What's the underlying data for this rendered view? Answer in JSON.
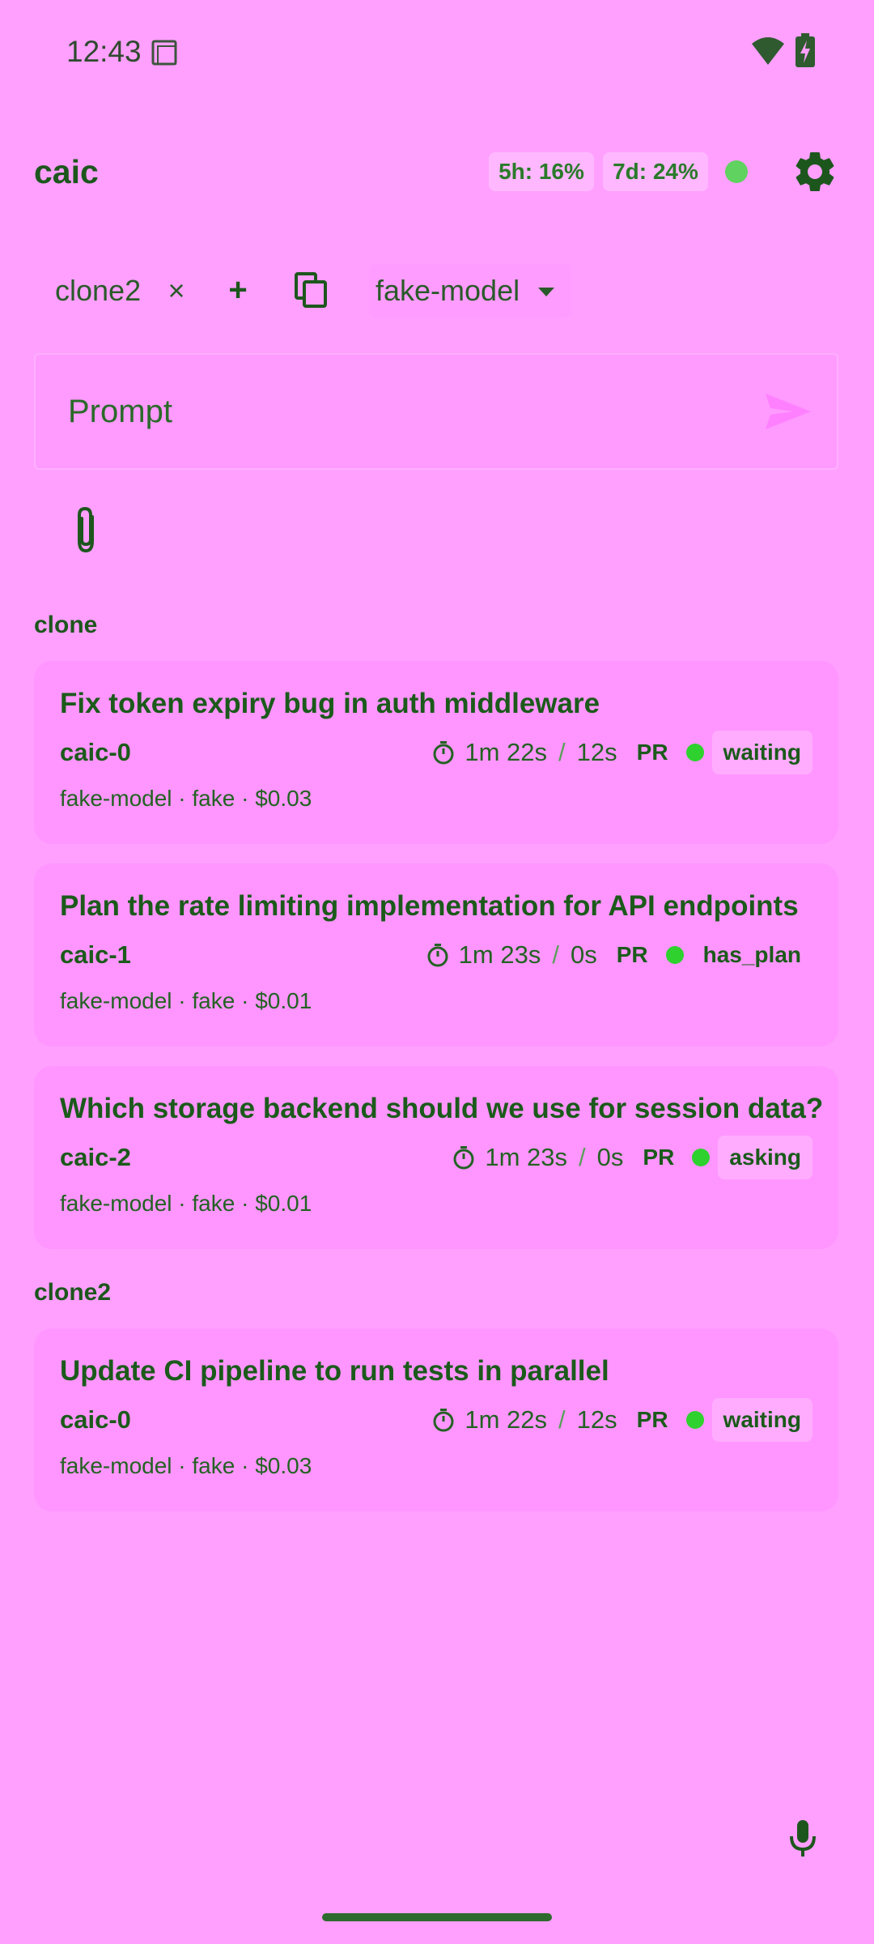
{
  "status_bar": {
    "time": "12:43",
    "icons": [
      "notification-icon",
      "wifi-icon",
      "battery-charging-icon"
    ]
  },
  "header": {
    "title": "caic",
    "usage_5h": "5h: 16%",
    "usage_7d": "7d: 24%",
    "connection_status_color": "#5fd25f",
    "settings_icon": "gear-icon"
  },
  "repo_bar": {
    "repo": "clone2",
    "remove_label": "×",
    "add_label": "+",
    "copy_icon": "copy-icon",
    "model": "fake-model"
  },
  "prompt": {
    "placeholder": "Prompt",
    "value": "",
    "send_icon": "send-icon",
    "attach_icon": "paperclip-icon"
  },
  "groups": [
    {
      "label": "clone",
      "tasks": [
        {
          "title": "Fix token expiry bug in auth middleware",
          "id": "caic-0",
          "meta": "fake-model · fake · $0.03",
          "elapsed": "1m 22s",
          "separator": "/",
          "recent": "12s",
          "pr": "PR",
          "state": "waiting",
          "state_chip": true
        },
        {
          "title": "Plan the rate limiting implementation for API endpoints",
          "id": "caic-1",
          "meta": "fake-model · fake · $0.01",
          "elapsed": "1m 23s",
          "separator": "/",
          "recent": "0s",
          "pr": "PR",
          "state": "has_plan",
          "state_chip": false
        },
        {
          "title": "Which storage backend should we use for session data?",
          "id": "caic-2",
          "meta": "fake-model · fake · $0.01",
          "elapsed": "1m 23s",
          "separator": "/",
          "recent": "0s",
          "pr": "PR",
          "state": "asking",
          "state_chip": true
        }
      ]
    },
    {
      "label": "clone2",
      "tasks": [
        {
          "title": "Update CI pipeline to run tests in parallel",
          "id": "caic-0",
          "meta": "fake-model · fake · $0.03",
          "elapsed": "1m 22s",
          "separator": "/",
          "recent": "12s",
          "pr": "PR",
          "state": "waiting",
          "state_chip": true
        }
      ]
    }
  ],
  "footer": {
    "mic_icon": "microphone-icon"
  },
  "colors": {
    "background": "#ffa0ff",
    "card": "#ff96ff",
    "text": "#1b5a1b",
    "status_dot": "#2ed12e"
  }
}
